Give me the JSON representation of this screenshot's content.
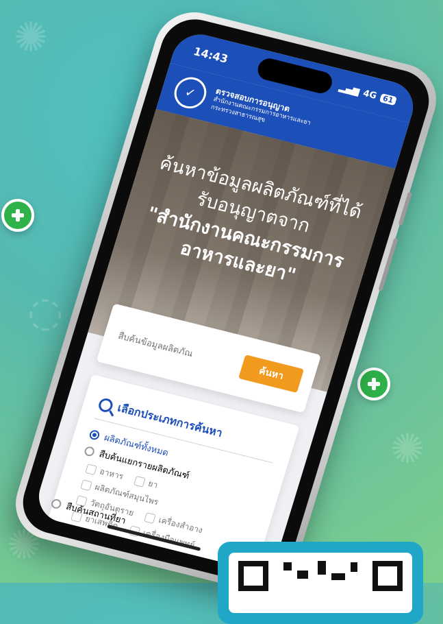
{
  "status_bar": {
    "time": "14:43",
    "network": "4G",
    "battery": "61"
  },
  "header": {
    "title": "ตรวจสอบการอนุญาต",
    "subtitle_1": "สำนักงานคณะกรรมการอาหารและยา",
    "subtitle_2": "กระทรวงสาธารณสุข"
  },
  "hero": {
    "line1": "ค้นหาข้อมูลผลิตภัณฑ์ที่ได้",
    "line2": "รับอนุญาตจาก",
    "line3": "\"สำนักงานคณะกรรมการ",
    "line4": "อาหารและยา\""
  },
  "search": {
    "placeholder": "สืบค้นข้อมูลผลิตภัณ",
    "button_label": "ค้นหา"
  },
  "filter": {
    "title": "เลือกประเภทการค้นหา",
    "options": [
      {
        "label": "ผลิตภัณฑ์ทั้งหมด",
        "checked": true
      },
      {
        "label": "สืบค้นแยกรายผลิตภัณฑ์",
        "checked": false
      }
    ],
    "checkboxes": [
      [
        "อาหาร",
        "ยา"
      ],
      [
        "ผลิตภัณฑ์สมุนไพร"
      ],
      [
        "วัตถุอันตราย",
        "เครื่องสำอาง"
      ],
      [
        "ยาเสพติด",
        "เครื่องมือแพทย์"
      ]
    ],
    "last_option": "สืบค้นสถานที่ยา"
  },
  "colors": {
    "primary": "#1d4fb8",
    "accent": "#f29a1e",
    "plus": "#2fb24a"
  }
}
